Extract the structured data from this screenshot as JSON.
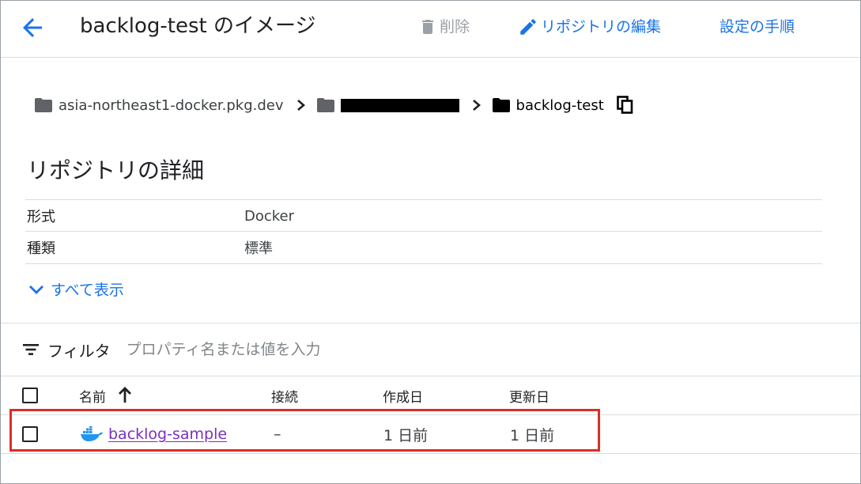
{
  "header": {
    "back_icon": "arrow-back-icon",
    "title": "backlog-test のイメージ",
    "delete_label": "削除",
    "delete_icon": "trash-icon",
    "edit_label": "リポジトリの編集",
    "edit_icon": "pencil-icon",
    "setup_label": "設定の手順"
  },
  "breadcrumb": {
    "host": "asia-northeast1-docker.pkg.dev",
    "project": "",
    "repo": "backlog-test",
    "folder_icon": "folder-icon",
    "separator_icon": "chevron-right-icon",
    "copy_icon": "copy-icon"
  },
  "details": {
    "title": "リポジトリの詳細",
    "rows": [
      {
        "key": "形式",
        "value": "Docker"
      },
      {
        "key": "種類",
        "value": "標準"
      }
    ],
    "show_all_label": "すべて表示",
    "show_all_icon": "chevron-down-icon"
  },
  "filter": {
    "icon": "filter-list-icon",
    "label": "フィルタ",
    "placeholder": "プロパティ名または値を入力",
    "value": ""
  },
  "table": {
    "columns": {
      "name": "名前",
      "connection": "接続",
      "created": "作成日",
      "updated": "更新日"
    },
    "sort_icon": "arrow-up-icon",
    "rows": [
      {
        "name": "backlog-sample",
        "icon": "docker-icon",
        "connection": "–",
        "created": "1 日前",
        "updated": "1 日前"
      }
    ]
  },
  "colors": {
    "accent": "#1a73e8",
    "link_visited": "#7b2fbe",
    "highlight": "#d93025",
    "disabled": "#9aa0a6"
  }
}
